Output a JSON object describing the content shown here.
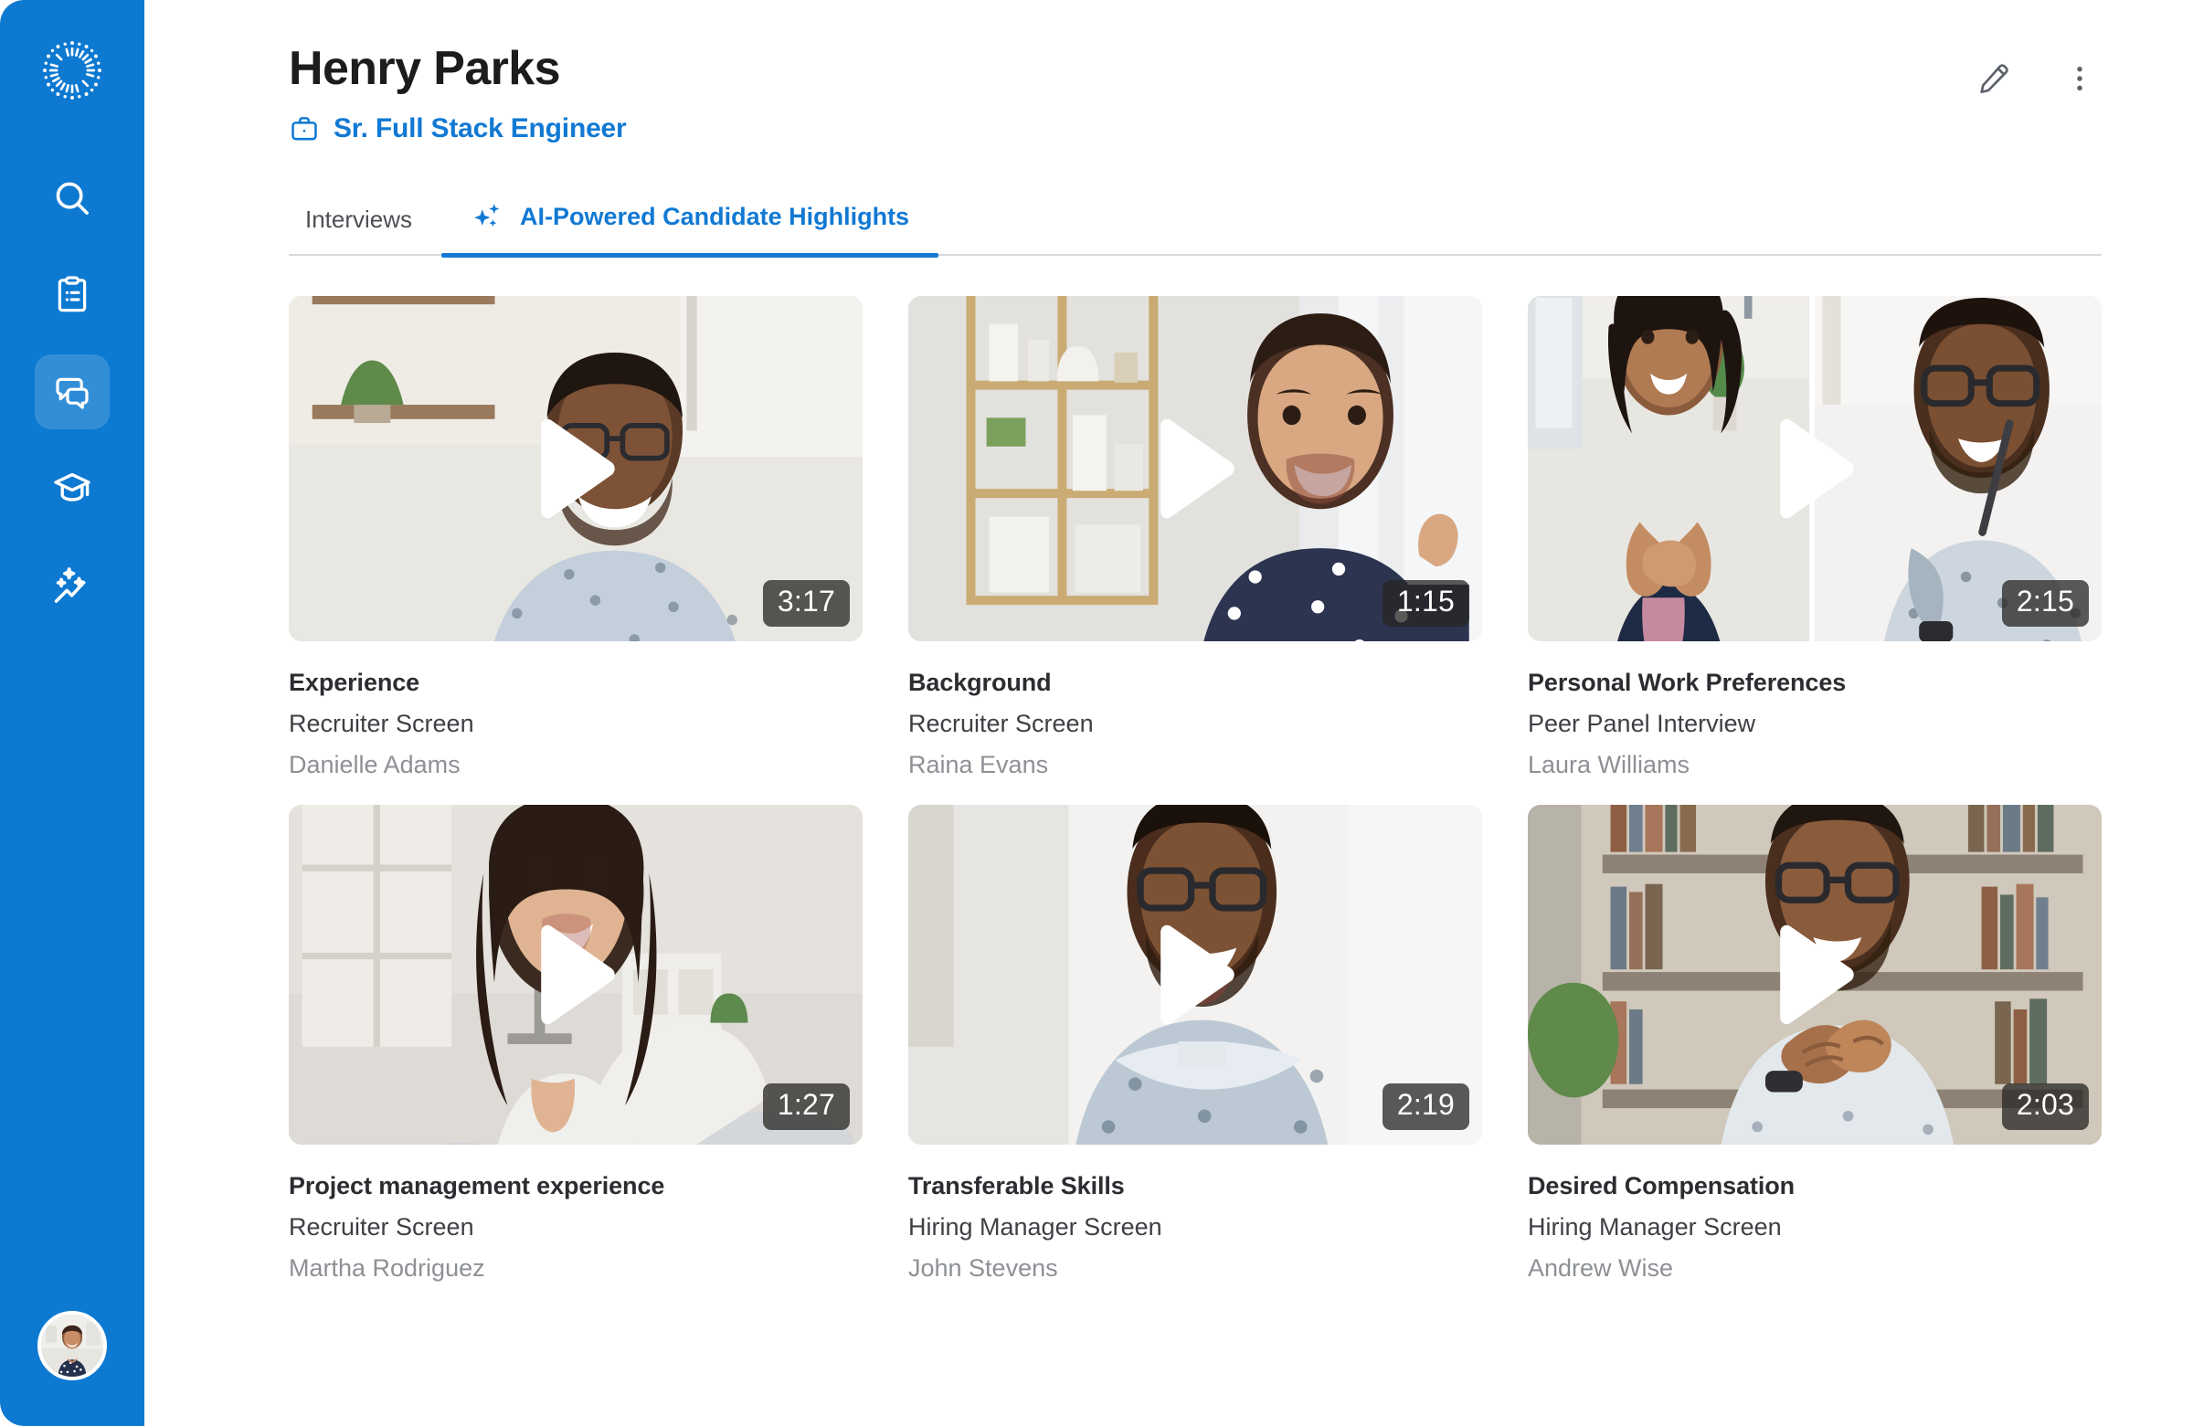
{
  "brand": {
    "logo_icon": "sunburst-logo-icon",
    "sidebar_color": "#0d79d1",
    "accent_color": "#1179d4"
  },
  "sidebar": {
    "items": [
      {
        "icon": "search-icon",
        "name": "search",
        "active": false
      },
      {
        "icon": "clipboard-list-icon",
        "name": "jobs",
        "active": false
      },
      {
        "icon": "chat-bubbles-icon",
        "name": "interviews",
        "active": true
      },
      {
        "icon": "graduation-cap-icon",
        "name": "learning",
        "active": false
      },
      {
        "icon": "ai-insights-icon",
        "name": "insights",
        "active": false
      }
    ],
    "avatar": {
      "icon": "user-avatar",
      "name": "current-user-avatar"
    }
  },
  "header": {
    "title": "Henry Parks",
    "role_icon": "briefcase-icon",
    "role": "Sr. Full Stack Engineer",
    "actions": [
      {
        "icon": "pencil-edit-icon",
        "name": "edit-candidate"
      },
      {
        "icon": "more-vertical-icon",
        "name": "more-options"
      }
    ]
  },
  "tabs": [
    {
      "label": "Interviews",
      "icon": null,
      "active": false
    },
    {
      "label": "AI-Powered Candidate Highlights",
      "icon": "sparkles-icon",
      "active": true
    }
  ],
  "highlights": [
    {
      "title": "Experience",
      "stage": "Recruiter Screen",
      "person": "Danielle Adams",
      "duration": "3:17",
      "thumb": "man-glasses-shelf"
    },
    {
      "title": "Background",
      "stage": "Recruiter Screen",
      "person": "Raina Evans",
      "duration": "1:15",
      "thumb": "woman-polka-dot-shelf"
    },
    {
      "title": "Personal Work Preferences",
      "stage": "Peer Panel Interview",
      "person": "Laura Williams",
      "duration": "2:15",
      "thumb": "split-two-people"
    },
    {
      "title": "Project management experience",
      "stage": "Recruiter Screen",
      "person": "Martha Rodriguez",
      "duration": "1:27",
      "thumb": "woman-long-hair-livingroom"
    },
    {
      "title": "Transferable Skills",
      "stage": "Hiring Manager Screen",
      "person": "John Stevens",
      "duration": "2:19",
      "thumb": "man-beard-bright"
    },
    {
      "title": "Desired Compensation",
      "stage": "Hiring Manager Screen",
      "person": "Andrew Wise",
      "duration": "2:03",
      "thumb": "man-bookshelf"
    }
  ]
}
